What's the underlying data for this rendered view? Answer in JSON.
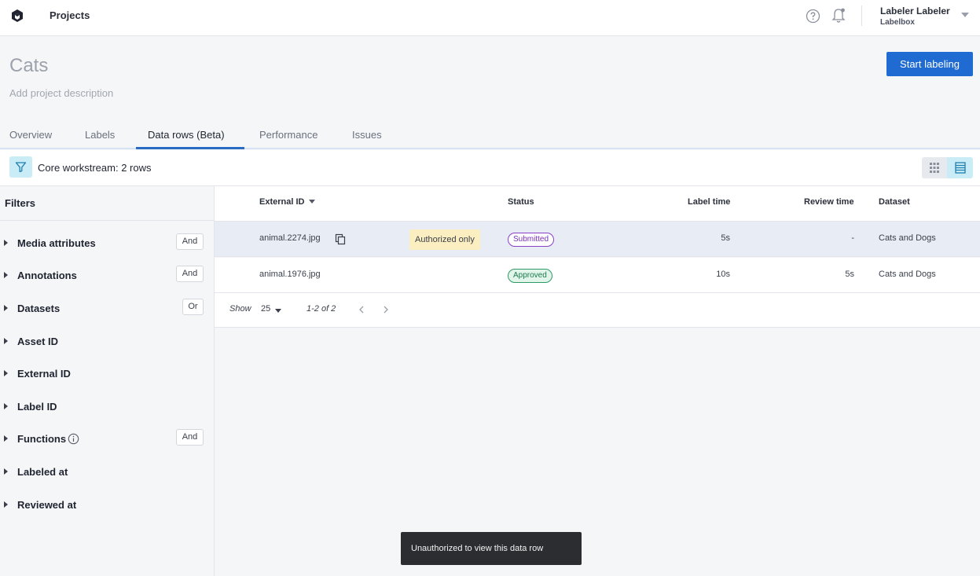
{
  "topbar": {
    "title": "Projects",
    "user_name": "Labeler Labeler",
    "user_org": "Labelbox",
    "icons": [
      "labelbox-logo-icon",
      "help-icon",
      "bell-icon",
      "chevron-down-icon"
    ]
  },
  "header": {
    "project_title": "Cats",
    "description_placeholder": "Add project description",
    "start_button": "Start labeling"
  },
  "tabs": [
    {
      "label": "Overview",
      "active": false
    },
    {
      "label": "Labels",
      "active": false
    },
    {
      "label": "Data rows (Beta)",
      "active": true
    },
    {
      "label": "Performance",
      "active": false
    },
    {
      "label": "Issues",
      "active": false
    }
  ],
  "filterbar": {
    "summary": "Core workstream: 2 rows"
  },
  "sidebar": {
    "heading": "Filters",
    "items": [
      {
        "label": "Media attributes",
        "op": "And"
      },
      {
        "label": "Annotations",
        "op": "And"
      },
      {
        "label": "Datasets",
        "op": "Or"
      },
      {
        "label": "Asset ID",
        "op": ""
      },
      {
        "label": "External ID",
        "op": ""
      },
      {
        "label": "Label ID",
        "op": ""
      },
      {
        "label": "Functions",
        "op": "And"
      },
      {
        "label": "Labeled at",
        "op": ""
      },
      {
        "label": "Reviewed at",
        "op": ""
      }
    ]
  },
  "table": {
    "columns": [
      "External ID",
      "Status",
      "Label time",
      "Review time",
      "Dataset"
    ],
    "rows": [
      {
        "external_id": "animal.2274.jpg",
        "access": "Authorized only",
        "status": "Submitted",
        "label_time": "5s",
        "review_time": "-",
        "dataset": "Cats and Dogs"
      },
      {
        "external_id": "animal.1976.jpg",
        "access": "",
        "status": "Approved",
        "label_time": "10s",
        "review_time": "5s",
        "dataset": "Cats and Dogs"
      }
    ],
    "colors": {
      "submitted": "#7a2fb9",
      "approved": "#1c7a4c"
    }
  },
  "pager": {
    "show_label": "Show",
    "page_size": "25",
    "range": "1-2 of 2"
  },
  "toast": {
    "message": "Unauthorized to view this data row"
  },
  "colors": {
    "primary": "#1f6bd1",
    "accent_light": "#c9ecf7"
  }
}
